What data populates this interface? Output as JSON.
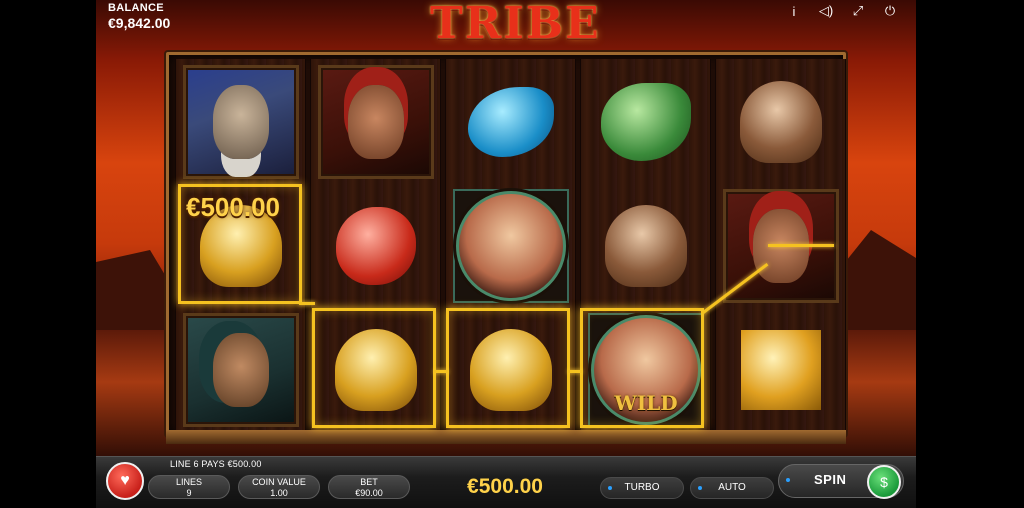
{
  "game": {
    "title": "TRIBE"
  },
  "balance": {
    "label": "BALANCE",
    "value": "€9,842.00"
  },
  "top_icons": [
    "info-icon",
    "sound-icon",
    "fullscreen-icon",
    "power-icon"
  ],
  "reels": [
    [
      "chief-portrait",
      "golden-octopus",
      "warrior-portrait"
    ],
    [
      "woman-portrait",
      "red-turtle-amulet",
      "golden-octopus"
    ],
    [
      "blue-dolphin-amulet",
      "canoe-wild",
      "golden-octopus"
    ],
    [
      "green-jade-amulet",
      "brown-octopus",
      "canoe-wild"
    ],
    [
      "brown-octopus",
      "woman-portrait",
      "gold-yinyang-amulet"
    ]
  ],
  "win": {
    "cell_amount": "€500.00",
    "line_text": "LINE 6 PAYS €500.00",
    "total": "€500.00"
  },
  "wild_label": "WILD",
  "controls": {
    "lines": {
      "label": "LINES",
      "value": "9"
    },
    "coin_value": {
      "label": "COIN VALUE",
      "value": "1.00"
    },
    "bet": {
      "label": "BET",
      "value": "€90.00"
    },
    "turbo_label": "TURBO",
    "auto_label": "AUTO",
    "spin_label": "SPIN"
  },
  "colors": {
    "highlight": "#f5c220",
    "win_text": "#ffd24a",
    "title": "#e8301a"
  }
}
